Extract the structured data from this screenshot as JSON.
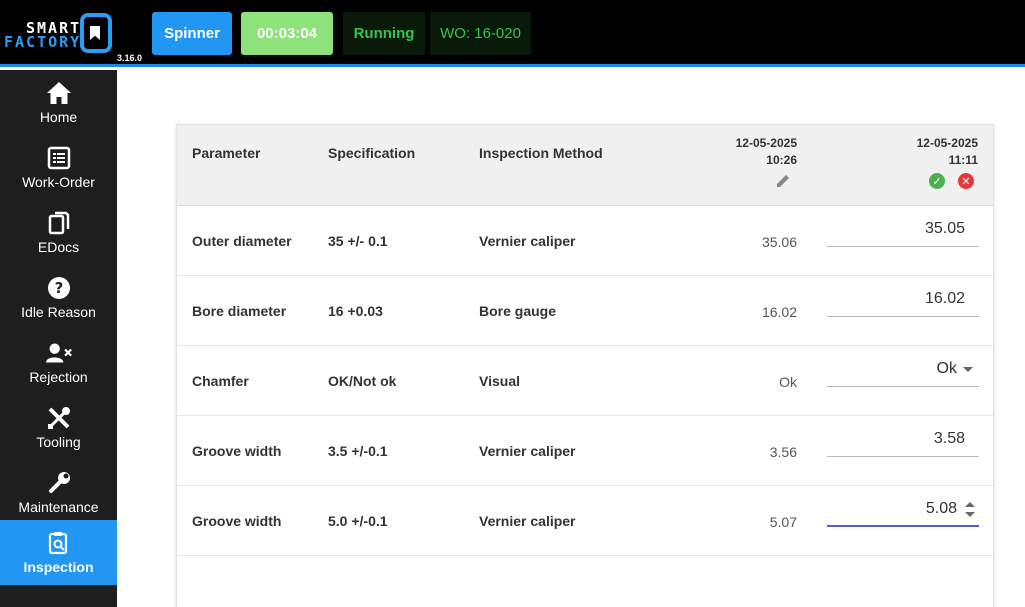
{
  "header": {
    "logo_line1": "SMART",
    "logo_line2": "FACTORY",
    "version": "3.16.0",
    "machine": "Spinner",
    "timer": "00:03:04",
    "status": "Running",
    "work_order": "WO: 16-020"
  },
  "sidebar": {
    "items": [
      {
        "label": "Home",
        "icon": "home-icon"
      },
      {
        "label": "Work-Order",
        "icon": "list-icon"
      },
      {
        "label": "EDocs",
        "icon": "documents-icon"
      },
      {
        "label": "Idle Reason",
        "icon": "question-icon"
      },
      {
        "label": "Rejection",
        "icon": "user-remove-icon"
      },
      {
        "label": "Tooling",
        "icon": "tools-icon"
      },
      {
        "label": "Maintenance",
        "icon": "wrench-icon"
      },
      {
        "label": "Inspection",
        "icon": "clipboard-search-icon",
        "active": true
      }
    ]
  },
  "table": {
    "headers": {
      "parameter": "Parameter",
      "specification": "Specification",
      "method": "Inspection Method"
    },
    "columns": [
      {
        "date": "12-05-2025",
        "time": "10:26"
      },
      {
        "date": "12-05-2025",
        "time": "11:11"
      }
    ],
    "rows": [
      {
        "parameter": "Outer diameter",
        "spec": "35 +/- 0.1",
        "method": "Vernier caliper",
        "prev": "35.06",
        "current": "35.05"
      },
      {
        "parameter": "Bore diameter",
        "spec": "16 +0.03",
        "method": "Bore gauge",
        "prev": "16.02",
        "current": "16.02"
      },
      {
        "parameter": "Chamfer",
        "spec": "OK/Not ok",
        "method": "Visual",
        "prev": "Ok",
        "current": "Ok"
      },
      {
        "parameter": "Groove width",
        "spec": "3.5 +/-0.1",
        "method": "Vernier caliper",
        "prev": "3.56",
        "current": "3.58"
      },
      {
        "parameter": "Groove width",
        "spec": "5.0 +/-0.1",
        "method": "Vernier caliper",
        "prev": "5.07",
        "current": "5.08"
      }
    ]
  },
  "colors": {
    "accent": "#2196f3",
    "timer": "#8ee27a",
    "status_text": "#39c24a",
    "confirm": "#4caf50",
    "cancel": "#e53935",
    "focus_underline": "#5c59d6"
  }
}
